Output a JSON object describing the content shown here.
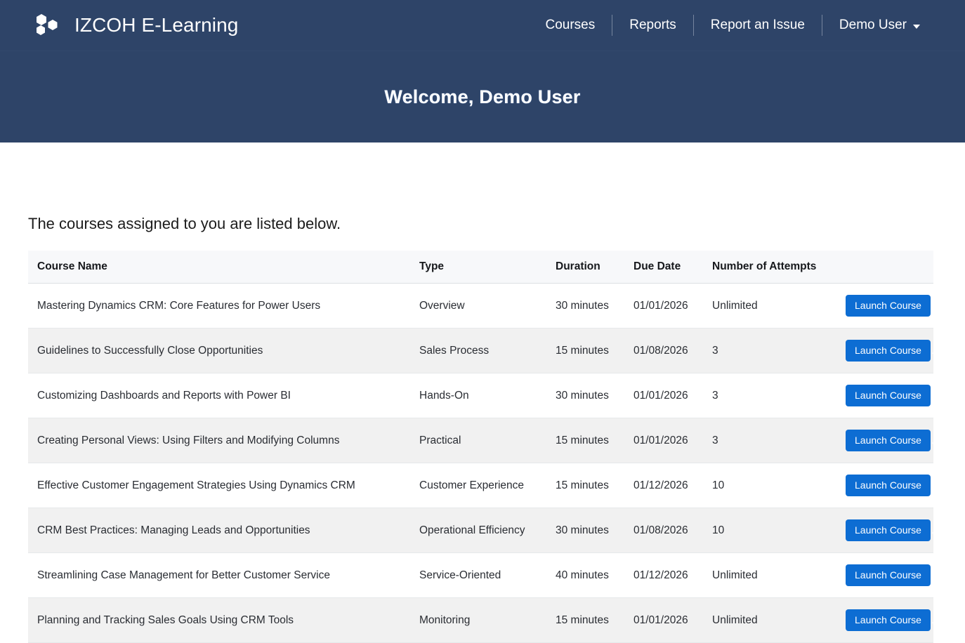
{
  "brand": {
    "name": "IZCOH E-Learning",
    "logo_icon": "hexagon-cluster-logo-icon"
  },
  "nav": {
    "items": [
      {
        "label": "Courses",
        "name": "nav-link-courses"
      },
      {
        "label": "Reports",
        "name": "nav-link-reports"
      },
      {
        "label": "Report an Issue",
        "name": "nav-link-report-an-issue"
      },
      {
        "label": "Demo User",
        "name": "nav-link-demo-user"
      }
    ]
  },
  "banner": {
    "title": "Welcome, Demo User"
  },
  "main": {
    "intro": "The courses assigned to you are listed below.",
    "table": {
      "columns": [
        "Course Name",
        "Type",
        "Duration",
        "Due Date",
        "Number of Attempts",
        ""
      ],
      "action_label": "Launch Course",
      "rows": [
        {
          "course_name": "Mastering Dynamics CRM: Core Features for Power Users",
          "type": "Overview",
          "duration": "30 minutes",
          "due_date": "01/01/2026",
          "attempts": "Unlimited"
        },
        {
          "course_name": "Guidelines to Successfully Close Opportunities",
          "type": "Sales Process",
          "duration": "15 minutes",
          "due_date": "01/08/2026",
          "attempts": "3"
        },
        {
          "course_name": "Customizing Dashboards and Reports with Power BI",
          "type": "Hands-On",
          "duration": "30 minutes",
          "due_date": "01/01/2026",
          "attempts": "3"
        },
        {
          "course_name": "Creating Personal Views: Using Filters and Modifying Columns",
          "type": "Practical",
          "duration": "15 minutes",
          "due_date": "01/01/2026",
          "attempts": "3"
        },
        {
          "course_name": "Effective Customer Engagement Strategies Using Dynamics CRM",
          "type": "Customer Experience",
          "duration": "15 minutes",
          "due_date": "01/12/2026",
          "attempts": "10"
        },
        {
          "course_name": "CRM Best Practices: Managing Leads and Opportunities",
          "type": "Operational Efficiency",
          "duration": "30 minutes",
          "due_date": "01/08/2026",
          "attempts": "10"
        },
        {
          "course_name": "Streamlining Case Management for Better Customer Service",
          "type": "Service-Oriented",
          "duration": "40 minutes",
          "due_date": "01/12/2026",
          "attempts": "Unlimited"
        },
        {
          "course_name": "Planning and Tracking Sales Goals Using CRM Tools",
          "type": "Monitoring",
          "duration": "15 minutes",
          "due_date": "01/01/2026",
          "attempts": "Unlimited"
        }
      ]
    }
  },
  "colors": {
    "navy": "#2e4468",
    "button_blue": "#0d6dd3",
    "header_row": "#f7f8fa",
    "striped_row": "#f1f1f1"
  }
}
